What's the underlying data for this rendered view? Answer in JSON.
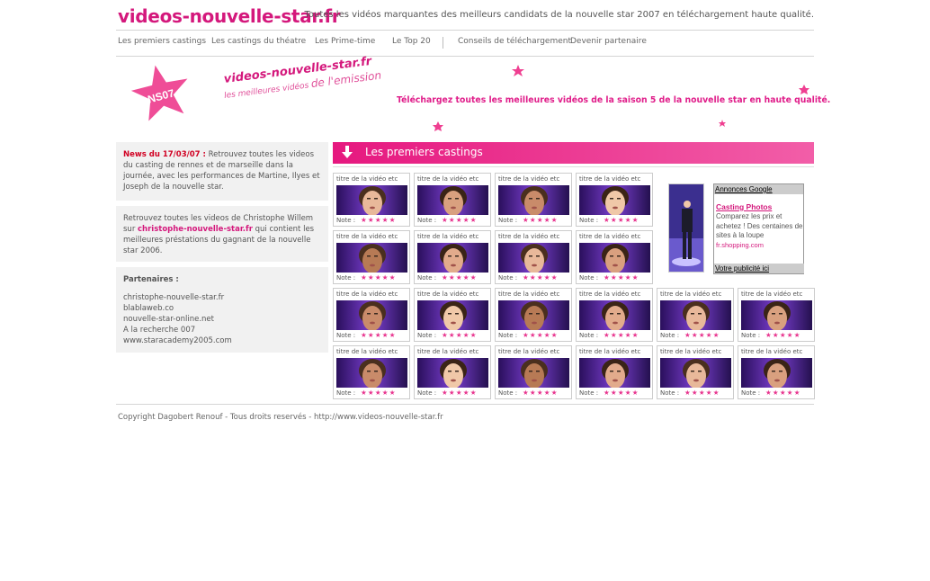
{
  "header": {
    "site_title": "videos-nouvelle-star.fr",
    "tagline": "Toutes les vidéos marquantes des meilleurs candidats de la nouvelle star 2007 en téléchargement haute qualité."
  },
  "nav": {
    "items": [
      "Les premiers castings",
      "Les castings du théatre",
      "Les Prime-time",
      "Le Top 20",
      "Conseils de téléchargement",
      "Devenir partenaire"
    ]
  },
  "banner": {
    "star_badge": "NS07",
    "logo_line1": "videos-nouvelle-star.fr",
    "logo_line2_small": "les meilleures vidéos",
    "logo_line2_big": "de l'emission",
    "headline": "Téléchargez toutes les meilleures vidéos de la saison 5 de la nouvelle star en haute qualité."
  },
  "sidebar": {
    "news_date": "News du 17/03/07 :",
    "news_body": " Retrouvez toutes les videos du casting de rennes et de marseille dans la journée, avec les performances de Martine, Ilyes et Joseph de la nouvelle star.",
    "promo_before": "Retrouvez toutes les videos de Christophe Willem sur ",
    "promo_link": "christophe-nouvelle-star.fr",
    "promo_after": " qui contient les meilleures préstations du gagnant de la nouvelle star 2006.",
    "partners_title": "Partenaires :",
    "partners": [
      "christophe-nouvelle-star.fr",
      "blablaweb.co",
      "nouvelle-star-online.net",
      "A la recherche 007",
      "www.staracademy2005.com"
    ]
  },
  "section": {
    "title": "Les premiers castings"
  },
  "videos": {
    "card_title": "titre de la vidéo etc",
    "note_label": "Note :",
    "rating": 3,
    "rating_max": 5,
    "rows": [
      4,
      4,
      6,
      6
    ]
  },
  "ad": {
    "header": "Annonces Google",
    "title": "Casting Photos",
    "body": "Comparez les prix et achetez ! Des centaines de sites à la loupe",
    "url": "fr.shopping.com",
    "footer": "Votre publicité ici"
  },
  "footer": {
    "text": "Copyright Dagobert Renouf - Tous droits reservés - http://www.videos-nouvelle-star.fr"
  },
  "colors": {
    "brand": "#d4187c",
    "bar_start": "#e6187f",
    "bar_end": "#f25ea8",
    "star": "#e8358f"
  }
}
